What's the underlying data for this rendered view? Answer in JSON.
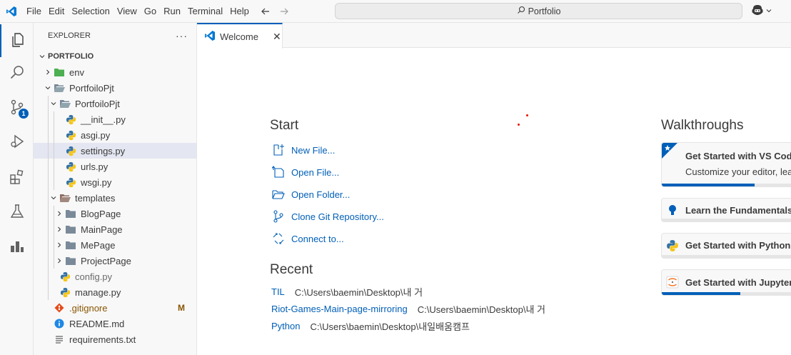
{
  "menu": [
    "File",
    "Edit",
    "Selection",
    "View",
    "Go",
    "Run",
    "Terminal",
    "Help"
  ],
  "command_center": {
    "label": "Portfolio"
  },
  "activity": {
    "scm_badge": "1"
  },
  "explorer": {
    "title": "EXPLORER",
    "more": "···",
    "root": "PORTFOLIO",
    "items": [
      {
        "label": "env",
        "depth": 1,
        "type": "folder-env",
        "chevron": "right"
      },
      {
        "label": "PortfoiloPjt",
        "depth": 1,
        "type": "folder-open",
        "chevron": "down"
      },
      {
        "label": "PortfoiloPjt",
        "depth": 2,
        "type": "folder-open",
        "chevron": "down"
      },
      {
        "label": "__init__.py",
        "depth": 3,
        "type": "python"
      },
      {
        "label": "asgi.py",
        "depth": 3,
        "type": "python"
      },
      {
        "label": "settings.py",
        "depth": 3,
        "type": "python",
        "selected": true
      },
      {
        "label": "urls.py",
        "depth": 3,
        "type": "python"
      },
      {
        "label": "wsgi.py",
        "depth": 3,
        "type": "python"
      },
      {
        "label": "templates",
        "depth": 2,
        "type": "folder-templates",
        "chevron": "down"
      },
      {
        "label": "BlogPage",
        "depth": 3,
        "type": "folder",
        "chevron": "right"
      },
      {
        "label": "MainPage",
        "depth": 3,
        "type": "folder",
        "chevron": "right"
      },
      {
        "label": "MePage",
        "depth": 3,
        "type": "folder",
        "chevron": "right"
      },
      {
        "label": "ProjectPage",
        "depth": 3,
        "type": "folder",
        "chevron": "right"
      },
      {
        "label": "config.py",
        "depth": 2,
        "type": "python",
        "dim": true
      },
      {
        "label": "manage.py",
        "depth": 2,
        "type": "python"
      },
      {
        "label": ".gitignore",
        "depth": 1,
        "type": "git",
        "git": "M"
      },
      {
        "label": "README.md",
        "depth": 1,
        "type": "info"
      },
      {
        "label": "requirements.txt",
        "depth": 1,
        "type": "text"
      }
    ]
  },
  "tab": {
    "label": "Welcome",
    "close": "✕"
  },
  "welcome": {
    "start_title": "Start",
    "start_items": [
      {
        "label": "New File...",
        "icon": "new-file-icon"
      },
      {
        "label": "Open File...",
        "icon": "open-file-icon"
      },
      {
        "label": "Open Folder...",
        "icon": "open-folder-icon"
      },
      {
        "label": "Clone Git Repository...",
        "icon": "git-clone-icon"
      },
      {
        "label": "Connect to...",
        "icon": "remote-icon"
      }
    ],
    "recent_title": "Recent",
    "recent": [
      {
        "name": "TIL",
        "path": "C:\\Users\\baemin\\Desktop\\내 거"
      },
      {
        "name": "Riot-Games-Main-page-mirroring",
        "path": "C:\\Users\\baemin\\Desktop\\내 거"
      },
      {
        "name": "Python",
        "path": "C:\\Users\\baemin\\Desktop\\내일배움캠프"
      }
    ],
    "walk_title": "Walkthroughs",
    "walkthroughs": [
      {
        "title": "Get Started with VS Code",
        "desc": "Customize your editor, learn the basics",
        "progress": 0.65
      },
      {
        "title": "Learn the Fundamentals",
        "progress": 0
      },
      {
        "title": "Get Started with Python",
        "progress": 0
      },
      {
        "title": "Get Started with Jupyter",
        "progress": 0.55
      }
    ]
  }
}
